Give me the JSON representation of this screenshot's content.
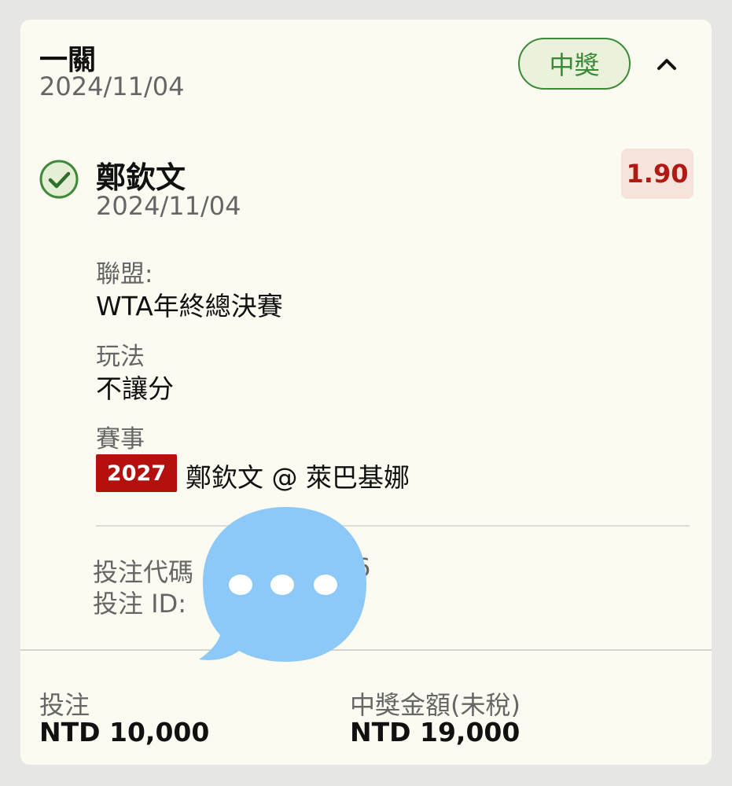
{
  "header": {
    "title": "一關",
    "date": "2024/11/04",
    "status_badge": "中獎"
  },
  "selection": {
    "name": "鄭欽文",
    "date": "2024/11/04",
    "odds": "1.90"
  },
  "league": {
    "label": "聯盟:",
    "value": "WTA年終總決賽"
  },
  "play": {
    "label": "玩法",
    "value": "不讓分"
  },
  "event": {
    "label": "賽事",
    "code": "2027",
    "match": "鄭欽文 @ 萊巴基娜"
  },
  "meta": {
    "bet_code_label": "投注代碼",
    "bet_code_tail": "6",
    "bet_id_label": "投注 ID:"
  },
  "footer": {
    "stake_label": "投注",
    "stake_value": "NTD 10,000",
    "payout_label": "中獎金額(未稅)",
    "payout_value": "NTD 19,000"
  },
  "colors": {
    "win_green": "#3a8a35",
    "odds_red": "#b01a12",
    "code_red": "#b3100e",
    "overlay_blue": "#8cc8f8"
  },
  "icons": {
    "collapse": "chevron-up-icon",
    "status": "check-circle-icon",
    "overlay": "chat-bubble-icon"
  }
}
